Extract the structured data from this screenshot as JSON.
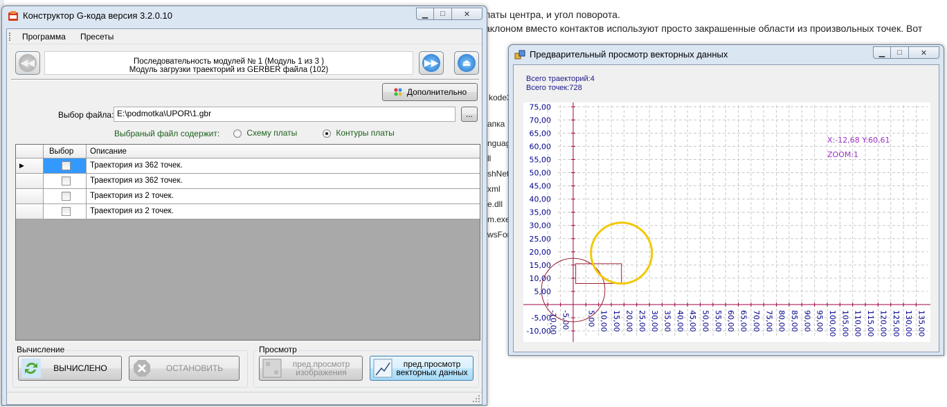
{
  "background": {
    "line1": "латы центра, и угол поворота.",
    "line2": "аклоном вместо контактов используют просто закрашенные области из произвольных точек. Вот",
    "fragments": [
      "kode3",
      "апка",
      "nguag",
      "ll",
      "shNet",
      "xml",
      "e.dll",
      "m.exe",
      "wsFor"
    ]
  },
  "main_window": {
    "title": "Конструктор G-кода версия 3.2.0.10",
    "menu": [
      "Программа",
      "Пресеты"
    ],
    "sequence_line1": "Последовательность модулей № 1 (Модуль 1 из 3 )",
    "sequence_line2": "Модуль загрузки траекторий из GERBER файла (102)",
    "extra_button": "Дополнительно",
    "file_label": "Выбор файла:",
    "file_value": "E:\\podmotka\\UPOR\\1.gbr",
    "browse_label": "...",
    "contains_label": "Выбраный файл содержит:",
    "radio_schema": "Схему платы",
    "radio_contours": "Контуры платы",
    "radio_selected": "contours",
    "table": {
      "columns": [
        "Выбор",
        "Описание"
      ],
      "rows": [
        {
          "checked": false,
          "description": "Траектория из 362 точек."
        },
        {
          "checked": false,
          "description": "Траектория из 362 точек."
        },
        {
          "checked": false,
          "description": "Траектория из 2 точек."
        },
        {
          "checked": false,
          "description": "Траектория из 2 точек."
        }
      ]
    },
    "calc_group": "Вычисление",
    "view_group": "Просмотр",
    "btn_calculated": "ВЫЧИСЛЕНО",
    "btn_stop": "ОСТАНОВИТЬ",
    "btn_preview_image_1": "пред.просмотр",
    "btn_preview_image_2": "изображения",
    "btn_preview_vector_1": "пред.просмотр",
    "btn_preview_vector_2": "векторных данных"
  },
  "preview_window": {
    "title": "Предварительный просмотр векторных данных",
    "stat_trajectories": "Всего траекторий:4",
    "stat_points": "Всего точек:728",
    "coord_readout": "X:-12,68 Y:60,61",
    "zoom_readout": "ZOOM:1",
    "y_ticks": [
      "75,00",
      "70,00",
      "65,00",
      "60,00",
      "55,00",
      "50,00",
      "45,00",
      "40,00",
      "35,00",
      "30,00",
      "25,00",
      "20,00",
      "15,00",
      "10,00",
      "5,00",
      "",
      "-5,00",
      "-10,00"
    ],
    "x_ticks": [
      "-10,00",
      "-5,00",
      "5,00",
      "10,00",
      "15,00",
      "20,00",
      "25,00",
      "30,00",
      "35,00",
      "40,00",
      "45,00",
      "50,00",
      "55,00",
      "60,00",
      "65,00",
      "70,00",
      "75,00",
      "80,00",
      "85,00",
      "90,00",
      "95,00",
      "100,00",
      "105,00",
      "110,00",
      "115,00",
      "120,00",
      "125,00",
      "130,00",
      "135,00"
    ],
    "colors": {
      "axis": "#a00040",
      "ticks": "#00008b",
      "grid": "#c8c8c8",
      "yellow_circle": "#f2c800",
      "red_shapes": "#9b1b2e",
      "readout": "#9b30c8"
    },
    "shapes": {
      "yellow_circle": {
        "cx": 19.0,
        "cy": 19.5,
        "r": 12.0
      },
      "red_circle": {
        "cx": 0.0,
        "cy": 5.5,
        "r": 12.5
      },
      "red_rectangle": {
        "x1": 1.0,
        "y1": 8.0,
        "x2": 19.0,
        "y2": 15.5
      }
    }
  }
}
